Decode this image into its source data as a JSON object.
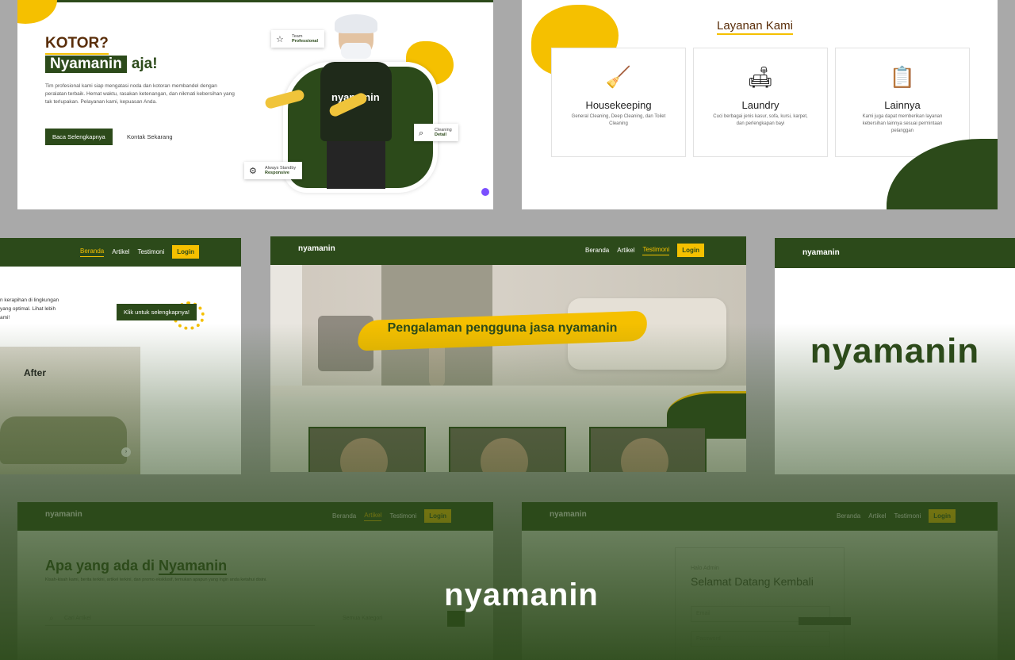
{
  "brand": "nyamanin",
  "colors": {
    "primary": "#2c4a1a",
    "accent": "#f5c000",
    "heading_brown": "#5a2e0a"
  },
  "hero": {
    "line1": "KOTOR?",
    "line2_box": "Nyamanin",
    "line2_rest": "aja!",
    "description": "Tim profesional kami siap mengatasi noda dan kotoran membandel dengan peralatan terbaik. Hemat waktu, rasakan ketenangan, dan nikmati kebersihan yang tak terlupakan. Pelayanan kami, kepuasan Anda.",
    "primary_button": "Baca Selengkapnya",
    "secondary_link": "Kontak Sekarang",
    "shirt_text": "nyamanin",
    "tags": [
      {
        "small": "Team",
        "bold": "Professional",
        "icon": "star-icon"
      },
      {
        "small": "Cleaning",
        "bold": "Detail",
        "icon": "search-icon"
      },
      {
        "small": "Always Standby",
        "bold": "Responsive",
        "icon": "gear-icon"
      }
    ]
  },
  "services": {
    "title": "Layanan Kami",
    "cards": [
      {
        "name": "Housekeeping",
        "desc": "General Cleaning, Deep Cleaning, dan Toilet Cleaning",
        "icon": "cleaner-icon"
      },
      {
        "name": "Laundry",
        "desc": "Cuci berbagai jenis kasur, sofa, kursi, karpet, dan perlengkapan bayi",
        "icon": "sofa-icon"
      },
      {
        "name": "Lainnya",
        "desc": "Kami juga dapat memberikan layanan kebersihan lainnya sesuai permintaan pelanggan",
        "icon": "checklist-icon"
      }
    ]
  },
  "nav": {
    "home": "Beranda",
    "articles": "Artikel",
    "testimonials": "Testimoni",
    "login": "Login"
  },
  "before_after": {
    "text_lines": [
      "n kerapihan di lingkungan",
      "yang optimal. Lihat lebih",
      "ami!"
    ],
    "cta": "Klik untuk selengkapnya!",
    "label": "After"
  },
  "testimonial": {
    "banner": "Pengalaman pengguna jasa nyamanin"
  },
  "articles": {
    "heading_plain": "Apa yang ada di ",
    "heading_underlined": "Nyamanin",
    "subtitle": "Kisah-kisah kami, berita terkini, artikel terkini, dan promo eksklusif, temukan apapun yang ingin anda ketahui disini.",
    "search_placeholder": "Cari Artikel",
    "filter": "Semua Kategori"
  },
  "login_page": {
    "greeting": "Halo Admin",
    "title": "Selamat Datang Kembali",
    "email_placeholder": "Email",
    "password_placeholder": "Password"
  },
  "overlay_logo": "nyamanin"
}
